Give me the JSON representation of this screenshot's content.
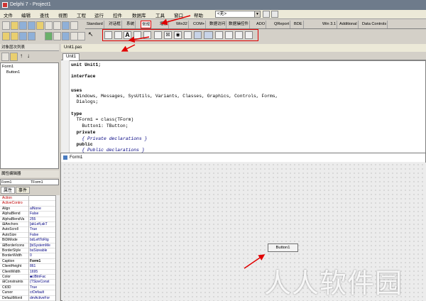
{
  "window": {
    "title": "Delphi 7 - Project1"
  },
  "menu": {
    "items": [
      "文件",
      "编辑",
      "查找",
      "视图",
      "工程",
      "运行",
      "控件",
      "数据库",
      "工具",
      "窗口",
      "帮助"
    ]
  },
  "toolbar": {
    "combo_value": "<无>"
  },
  "palette": {
    "tabs": [
      "Standard",
      "对话框",
      "系统",
      "常规",
      "增加",
      "Win32",
      "COM+",
      "数据访问",
      "数据操控件",
      "ADO",
      "QReport",
      "BDE",
      "Win 3.1",
      "Additional",
      "Data Controls"
    ],
    "selected_tab": "常规",
    "highlight_color": "#e00000"
  },
  "object_tree": {
    "header": "对象层次列表",
    "items": [
      "Form1",
      "Button1"
    ]
  },
  "editor": {
    "tab": "Unit1.pas",
    "file_tab": "Unit1",
    "lines": [
      "unit Unit1;",
      "",
      "interface",
      "",
      "uses",
      "  Windows, Messages, SysUtils, Variants, Classes, Graphics, Controls, Forms,",
      "  Dialogs;",
      "",
      "type",
      "  TForm1 = class(TForm)",
      "    Button1: TButton;",
      "  private",
      "    { Private declarations }",
      "  public",
      "    { Public declarations }"
    ]
  },
  "object_inspector": {
    "header": "属性编辑器",
    "object": "Form1",
    "class": "TForm1",
    "tabs": [
      "属性",
      "事件"
    ],
    "rows": [
      {
        "name": "Action",
        "value": ""
      },
      {
        "name": "ActiveContro",
        "value": ""
      },
      {
        "name": "Align",
        "value": "alNone"
      },
      {
        "name": "AlphaBlend",
        "value": "False"
      },
      {
        "name": "AlphaBlendVa",
        "value": "255"
      },
      {
        "name": "⊞Anchors",
        "value": "[akLeft,akT"
      },
      {
        "name": "AutoScroll",
        "value": "True"
      },
      {
        "name": "AutoSize",
        "value": "False"
      },
      {
        "name": "BiDiMode",
        "value": "bdLeftToRig"
      },
      {
        "name": "⊞BorderIcons",
        "value": "[biSystemMe"
      },
      {
        "name": "BorderStyle",
        "value": "bsSizeable"
      },
      {
        "name": "BorderWidth",
        "value": "0"
      },
      {
        "name": "Caption",
        "value": "Form1"
      },
      {
        "name": "ClientHeight",
        "value": "861"
      },
      {
        "name": "ClientWidth",
        "value": "1695"
      },
      {
        "name": "Color",
        "value": "■clBtnFac"
      },
      {
        "name": "⊞Constraints",
        "value": "(TSizeConst"
      },
      {
        "name": "Ctl3D",
        "value": "True"
      },
      {
        "name": "Cursor",
        "value": "crDefault"
      },
      {
        "name": "DefaultMonit",
        "value": "dmActiveFor"
      }
    ]
  },
  "designer": {
    "form_title": "Form1",
    "button_caption": "Button1"
  },
  "watermark": "人人软件园"
}
